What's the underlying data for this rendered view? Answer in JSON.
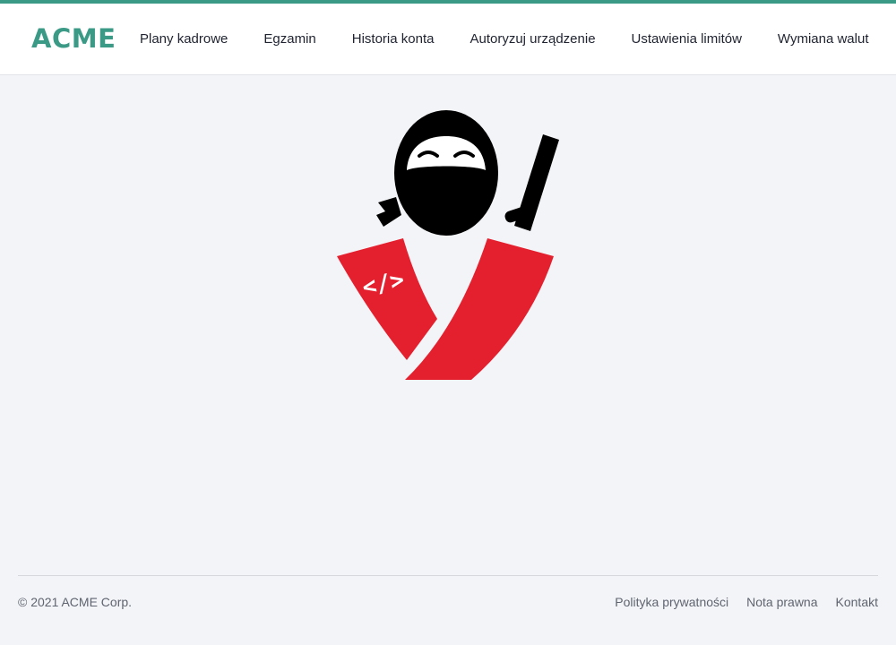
{
  "brand": {
    "logo_text": "ACME",
    "accent_color": "#3a9a86"
  },
  "nav": {
    "items": [
      {
        "label": "Plany kadrowe"
      },
      {
        "label": "Egzamin"
      },
      {
        "label": "Historia konta"
      },
      {
        "label": "Autoryzuj urządzenie"
      },
      {
        "label": "Ustawienia limitów"
      },
      {
        "label": "Wymiana walut"
      }
    ]
  },
  "hero": {
    "icon": "ninja-icon",
    "code_glyph": "</>",
    "colors": {
      "mask": "#000000",
      "sash": "#e4202f"
    }
  },
  "footer": {
    "copyright": "© 2021 ACME Corp.",
    "links": [
      {
        "label": "Polityka prywatności"
      },
      {
        "label": "Nota prawna"
      },
      {
        "label": "Kontakt"
      }
    ]
  }
}
